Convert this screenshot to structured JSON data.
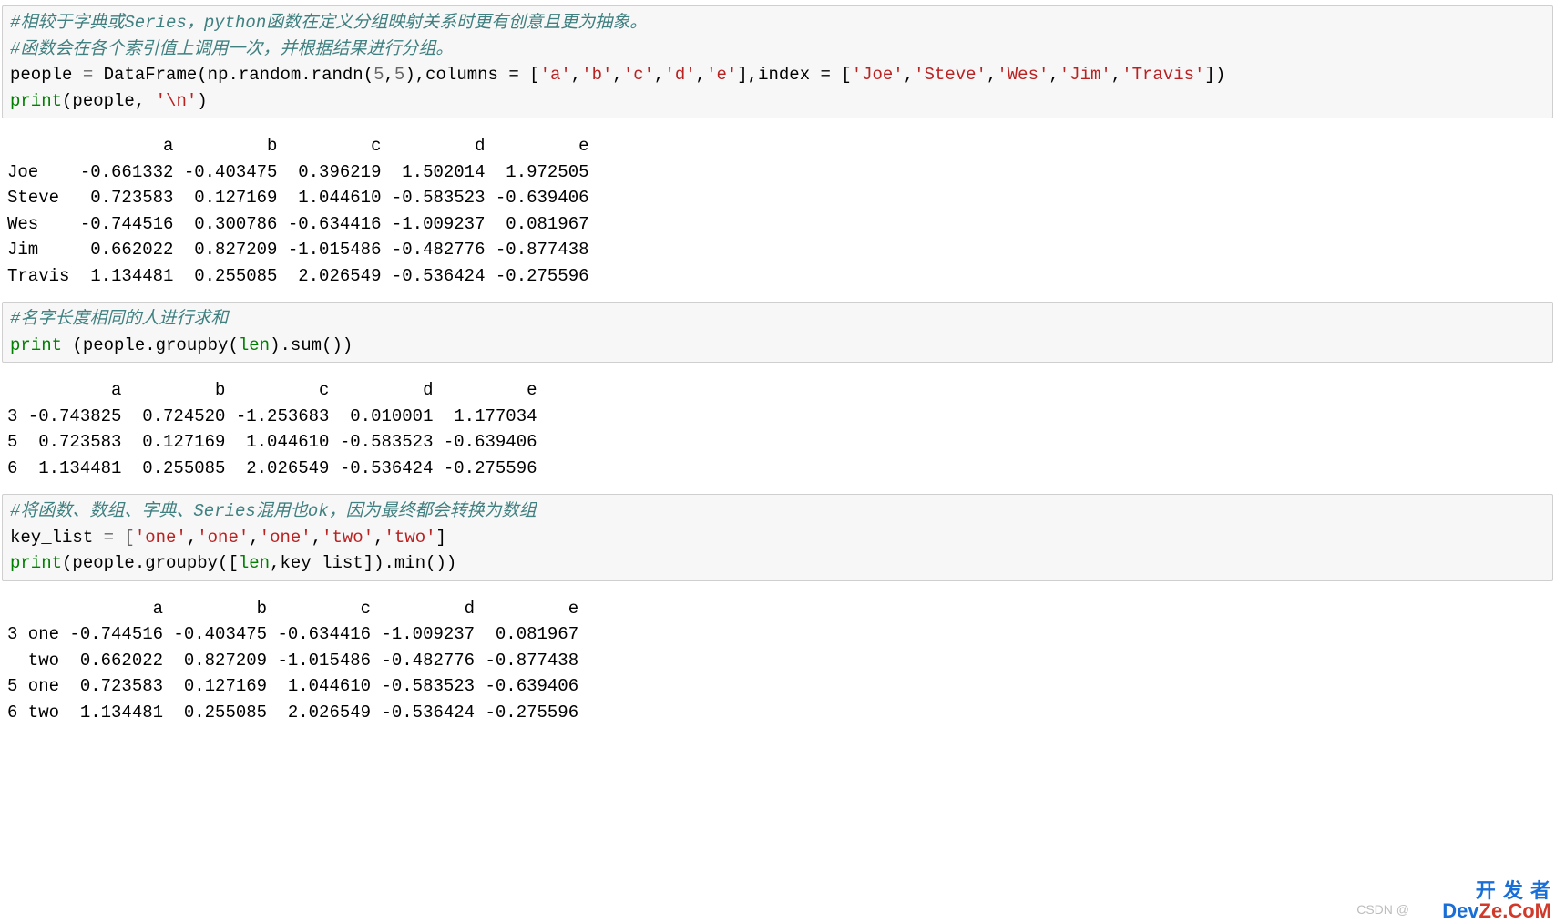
{
  "cell1": {
    "comment1": "#相较于字典或Series，python函数在定义分组映射关系时更有创意且更为抽象。",
    "comment2": "#函数会在各个索引值上调用一次，并根据结果进行分组。",
    "line3": {
      "people": "people",
      "eq": " = ",
      "DataFrame": "DataFrame",
      "open": "(np.random.randn(",
      "n1": "5",
      "comma1": ",",
      "n2": "5",
      "close1": "),columns = [",
      "sa": "'a'",
      "c1": ",",
      "sb": "'b'",
      "c2": ",",
      "sc": "'c'",
      "c3": ",",
      "sd": "'d'",
      "c4": ",",
      "se": "'e'",
      "mid": "],index = [",
      "sJoe": "'Joe'",
      "ic1": ",",
      "sSteve": "'Steve'",
      "ic2": ",",
      "sWes": "'Wes'",
      "ic3": ",",
      "sJim": "'Jim'",
      "ic4": ",",
      "sTravis": "'Travis'",
      "end": "])"
    },
    "line4": {
      "print": "print",
      "open": "(people, ",
      "nl": "'\\n'",
      "close": ")"
    }
  },
  "output1": "               a         b         c         d         e\nJoe    -0.661332 -0.403475  0.396219  1.502014  1.972505\nSteve   0.723583  0.127169  1.044610 -0.583523 -0.639406\nWes    -0.744516  0.300786 -0.634416 -1.009237  0.081967\nJim     0.662022  0.827209 -1.015486 -0.482776 -0.877438\nTravis  1.134481  0.255085  2.026549 -0.536424 -0.275596\n",
  "cell2": {
    "comment": "#名字长度相同的人进行求和",
    "line2": {
      "print": "print",
      "open": " (people.groupby(",
      "len": "len",
      "close": ").sum())"
    }
  },
  "output2": "          a         b         c         d         e\n3 -0.743825  0.724520 -1.253683  0.010001  1.177034\n5  0.723583  0.127169  1.044610 -0.583523 -0.639406\n6  1.134481  0.255085  2.026549 -0.536424 -0.275596",
  "cell3": {
    "comment": "#将函数、数组、字典、Series混用也ok，因为最终都会转换为数组",
    "line2": {
      "keylist": "key_list",
      "eq": " = [",
      "s1": "'one'",
      "c1": ",",
      "s2": "'one'",
      "c2": ",",
      "s3": "'one'",
      "c3": ",",
      "s4": "'two'",
      "c4": ",",
      "s5": "'two'",
      "end": "]"
    },
    "line3": {
      "print": "print",
      "open": "(people.groupby([",
      "len": "len",
      "mid": ",key_list]).min())"
    }
  },
  "output3": "              a         b         c         d         e\n3 one -0.744516 -0.403475 -0.634416 -1.009237  0.081967\n  two  0.662022  0.827209 -1.015486 -0.482776 -0.877438\n5 one  0.723583  0.127169  1.044610 -0.583523 -0.639406\n6 two  1.134481  0.255085  2.026549 -0.536424 -0.275596",
  "watermark": {
    "csdn": "CSDN @",
    "line1": "开 发 者",
    "line2a": "Dev",
    "line2b": "Ze.CoM"
  }
}
